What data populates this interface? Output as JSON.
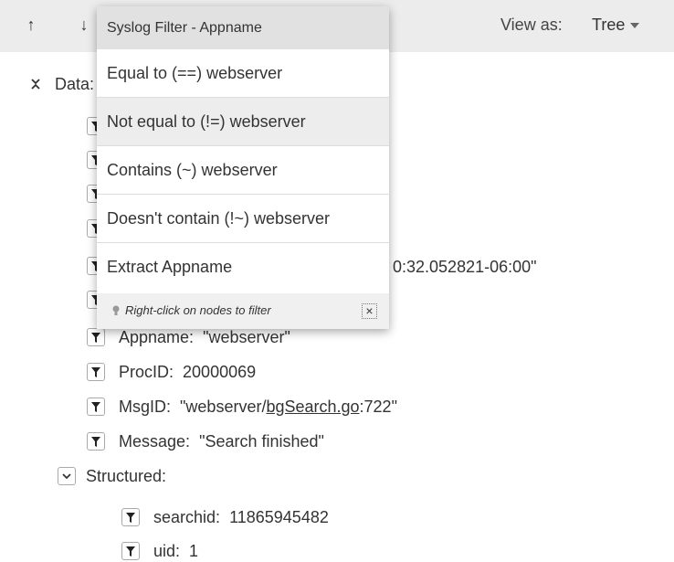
{
  "toolbar": {
    "up_arrow": "↑",
    "down_arrow": "↓",
    "view_as_label": "View as:",
    "view_as_value": "Tree"
  },
  "tree": {
    "root_label": "Data:",
    "timestamp_value_partial": "0:32.052821-06:00\"",
    "fields": [
      {
        "key": "Appname:",
        "value": "\"webserver\""
      },
      {
        "key": "ProcID:",
        "value": "20000069"
      },
      {
        "key": "MsgID:",
        "value_prefix": "\"webserver/",
        "value_link": "bgSearch.go",
        "value_suffix": ":722\""
      },
      {
        "key": "Message:",
        "value": "\"Search finished\""
      }
    ],
    "structured_label": "Structured:",
    "structured_fields": [
      {
        "key": "searchid:",
        "value": "11865945482"
      },
      {
        "key": "uid:",
        "value": "1"
      }
    ]
  },
  "popup": {
    "title": "Syslog Filter - Appname",
    "items": [
      "Equal to (==) webserver",
      "Not equal to (!=) webserver",
      "Contains (~) webserver",
      "Doesn't contain (!~) webserver",
      "Extract Appname"
    ],
    "hovered_index": 1,
    "hint": "Right-click on nodes to filter",
    "close_glyph": "×"
  }
}
